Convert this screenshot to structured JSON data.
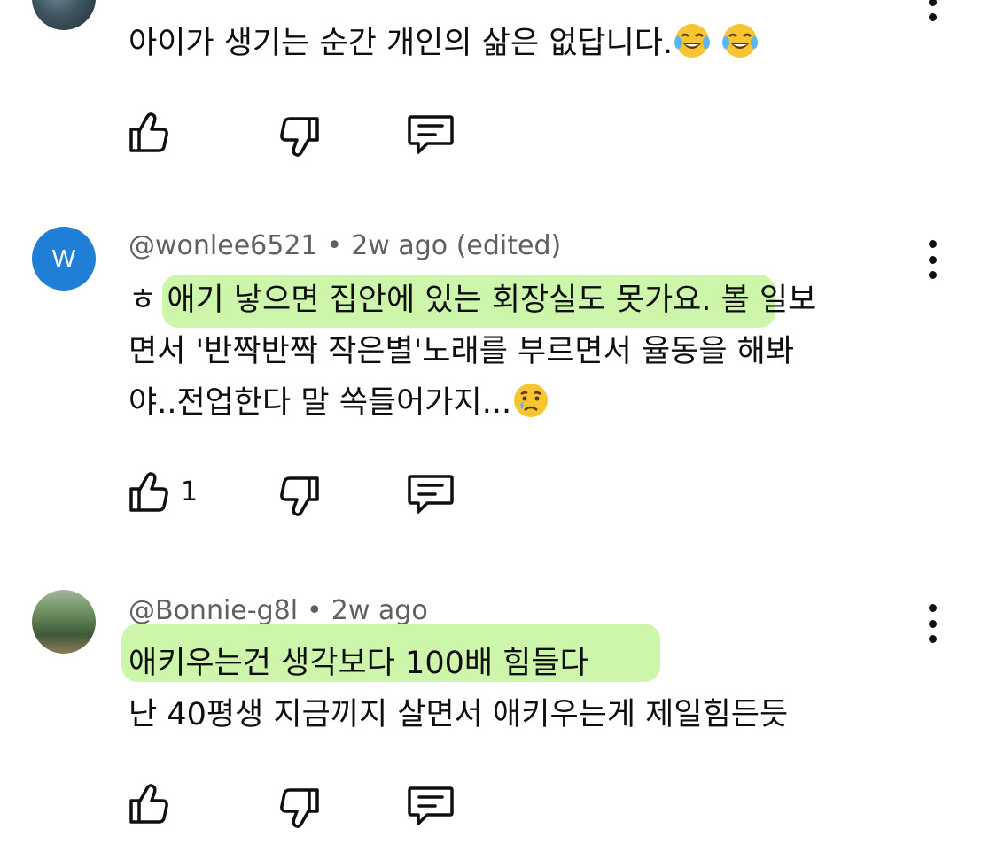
{
  "comments": [
    {
      "text": "아이가 생기는 순간 개인의 삶은 없답니다.",
      "emojis": [
        "😂",
        "😂"
      ],
      "like_count": "",
      "avatar_icon": "user-photo-avatar"
    },
    {
      "author": "@wonlee6521",
      "time": "2w ago (edited)",
      "avatar_letter": "W",
      "line1_pre": "ㅎ ",
      "line1_hl": "애기 낳으면 집안에 있는 회장실도 못가요.",
      "line1_post": " 볼 일보",
      "line2": "면서 '반짝반짝 작은별'노래를 부르면서 율동을 해봐",
      "line3": "야..전업한다 말 쏙들어가지...",
      "emoji": "😢",
      "like_count": "1"
    },
    {
      "author": "@Bonnie-g8l",
      "time": "2w ago",
      "line1_hl": "애키우는건 생각보다 100배 힘들다",
      "line2": "난 40평생 지금끼지 살면서 애키우는게 제일힘든듯",
      "like_count": ""
    }
  ],
  "separator": "•",
  "colors": {
    "highlight": "#c9f5a2",
    "avatar_w": "#1f7fd6",
    "meta_text": "#606060"
  }
}
